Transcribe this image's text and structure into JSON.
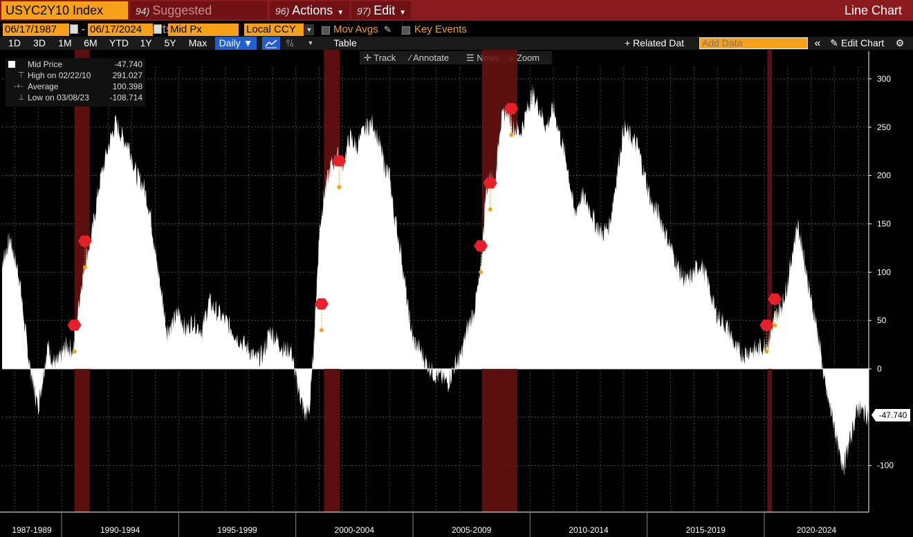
{
  "header": {
    "ticker": "USYC2Y10 Index",
    "menus": [
      {
        "num": "94)",
        "label": "Suggested Charts",
        "dim": true
      },
      {
        "num": "96)",
        "label": "Actions",
        "dim": false
      },
      {
        "num": "97)",
        "label": "Edit",
        "dim": false
      }
    ],
    "chart_type": "Line Chart"
  },
  "controls": {
    "start_date": "06/17/1987",
    "date_sep": "-",
    "end_date": "06/17/2024",
    "field": "Mid Px",
    "currency": "Local CCY",
    "mov_avgs": "Mov Avgs",
    "key_events": "Key Events"
  },
  "toolbar": {
    "periods": [
      "1D",
      "3D",
      "1M",
      "6M",
      "YTD",
      "1Y",
      "5Y",
      "Max"
    ],
    "frequency": "Daily ▼",
    "table": "Table",
    "related": "+ Related Dat",
    "add_data_placeholder": "Add Data",
    "collapse": "«",
    "edit_chart": "Edit Chart",
    "settings_icon": "⚙"
  },
  "tools": {
    "track": "Track",
    "annotate": "Annotate",
    "news": "News",
    "zoom": "Zoom"
  },
  "legend": {
    "rows": [
      {
        "icon": "",
        "label": "Mid Price",
        "value": "-47.740"
      },
      {
        "icon": "⊤",
        "label": "High on 02/22/10",
        "value": "291.027"
      },
      {
        "icon": "-+-",
        "label": "Average",
        "value": "100.398"
      },
      {
        "icon": "⊥",
        "label": "Low on 03/08/23",
        "value": "-108.714"
      }
    ]
  },
  "last_value": "-47.740",
  "colors": {
    "accent_orange": "#f6a117",
    "title_red": "#8b1a1f",
    "recession": "#6b1212",
    "event_marker": "#e8202a",
    "event_dot": "#f6a117",
    "series": "#ffffff"
  },
  "chart_data": {
    "type": "area",
    "title": "",
    "xlabel": "",
    "ylabel": "",
    "ylim": [
      -150,
      330
    ],
    "yticks": [
      300,
      250,
      200,
      150,
      100,
      50,
      0,
      -100
    ],
    "x_groups": [
      "1987-1989",
      "1990-1994",
      "1995-1999",
      "2000-2004",
      "2005-2009",
      "2010-2014",
      "2015-2019",
      "2020-2024"
    ],
    "xrange": [
      1987.46,
      2024.46
    ],
    "recessions": [
      [
        1990.55,
        1991.2
      ],
      [
        2001.2,
        2001.88
      ],
      [
        2007.95,
        2009.46
      ],
      [
        2020.13,
        2020.33
      ]
    ],
    "events": [
      {
        "t": 1990.55,
        "v": 18
      },
      {
        "t": 1991.0,
        "v": 105
      },
      {
        "t": 2001.1,
        "v": 40
      },
      {
        "t": 2001.85,
        "v": 188
      },
      {
        "t": 2007.9,
        "v": 100
      },
      {
        "t": 2008.3,
        "v": 165
      },
      {
        "t": 2009.2,
        "v": 242
      },
      {
        "t": 2020.1,
        "v": 18
      },
      {
        "t": 2020.45,
        "v": 45
      }
    ],
    "series": [
      {
        "x": [
          1987.46,
          1987.6,
          1987.8,
          1988.0,
          1988.2,
          1988.4,
          1988.6,
          1988.8,
          1989.0,
          1989.2,
          1989.4,
          1989.6,
          1989.8,
          1990.0,
          1990.2,
          1990.5,
          1990.8,
          1991.0,
          1991.3,
          1991.6,
          1992.0,
          1992.3,
          1992.6,
          1992.9,
          1993.2,
          1993.5,
          1993.8,
          1994.0,
          1994.2,
          1994.5,
          1994.8,
          1995.0,
          1995.3,
          1995.6,
          1996.0,
          1996.3,
          1996.6,
          1997.0,
          1997.3,
          1997.6,
          1998.0,
          1998.3,
          1998.6,
          1998.9,
          1999.2,
          1999.5,
          1999.8,
          2000.0,
          2000.2,
          2000.4,
          2000.6,
          2000.8,
          2001.0,
          2001.2,
          2001.5,
          2001.8,
          2002.0,
          2002.3,
          2002.6,
          2003.0,
          2003.3,
          2003.6,
          2003.8,
          2004.0,
          2004.2,
          2004.5,
          2004.8,
          2005.0,
          2005.3,
          2005.6,
          2005.9,
          2006.2,
          2006.5,
          2006.8,
          2007.0,
          2007.3,
          2007.6,
          2007.9,
          2008.1,
          2008.3,
          2008.5,
          2008.7,
          2009.0,
          2009.3,
          2009.6,
          2009.9,
          2010.1,
          2010.4,
          2010.7,
          2011.0,
          2011.3,
          2011.6,
          2011.9,
          2012.2,
          2012.5,
          2012.8,
          2013.1,
          2013.4,
          2013.7,
          2014.0,
          2014.3,
          2014.6,
          2014.9,
          2015.2,
          2015.5,
          2015.8,
          2016.1,
          2016.4,
          2016.7,
          2017.0,
          2017.3,
          2017.6,
          2017.9,
          2018.2,
          2018.5,
          2018.8,
          2019.1,
          2019.4,
          2019.7,
          2020.0,
          2020.2,
          2020.4,
          2020.6,
          2020.8,
          2021.0,
          2021.2,
          2021.4,
          2021.6,
          2021.8,
          2022.0,
          2022.2,
          2022.4,
          2022.6,
          2022.8,
          2023.0,
          2023.2,
          2023.4,
          2023.6,
          2023.8,
          2024.0,
          2024.2,
          2024.46
        ],
        "values": [
          110,
          120,
          135,
          115,
          95,
          50,
          10,
          -20,
          -40,
          -10,
          25,
          10,
          5,
          15,
          25,
          20,
          80,
          110,
          140,
          190,
          230,
          255,
          240,
          230,
          200,
          190,
          160,
          120,
          90,
          40,
          50,
          60,
          40,
          50,
          40,
          70,
          60,
          50,
          40,
          30,
          20,
          10,
          15,
          40,
          30,
          20,
          20,
          -10,
          -30,
          -50,
          -40,
          40,
          140,
          180,
          210,
          220,
          210,
          240,
          230,
          250,
          255,
          230,
          210,
          200,
          160,
          120,
          60,
          30,
          20,
          5,
          -5,
          -10,
          -15,
          5,
          10,
          40,
          60,
          100,
          180,
          200,
          190,
          250,
          270,
          250,
          245,
          270,
          285,
          270,
          250,
          270,
          240,
          210,
          160,
          180,
          170,
          150,
          140,
          150,
          200,
          250,
          240,
          230,
          200,
          170,
          160,
          140,
          120,
          100,
          90,
          100,
          110,
          90,
          60,
          50,
          40,
          20,
          15,
          20,
          20,
          25,
          30,
          50,
          60,
          70,
          90,
          120,
          150,
          130,
          100,
          70,
          50,
          20,
          -20,
          -40,
          -60,
          -90,
          -100,
          -80,
          -60,
          -40,
          -45,
          -47.74
        ]
      }
    ]
  }
}
